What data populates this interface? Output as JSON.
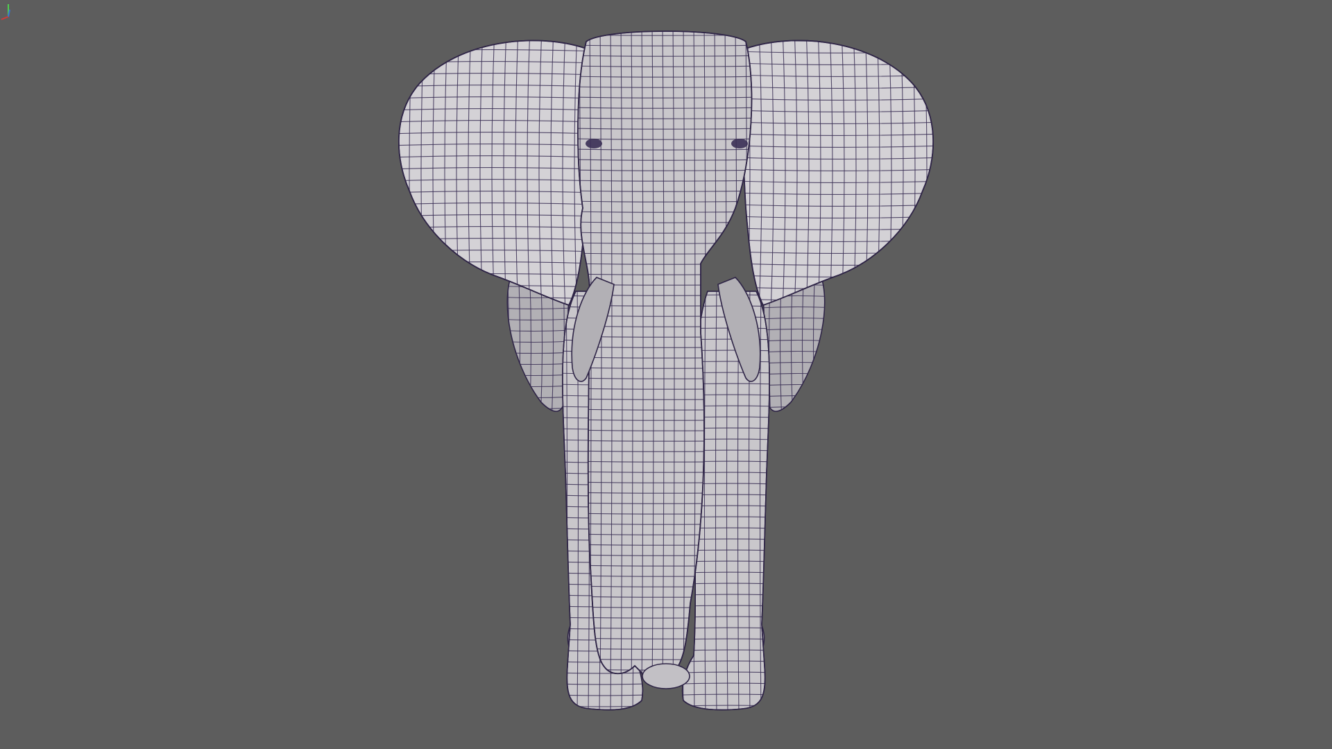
{
  "viewport": {
    "background_color": "#5d5d5d",
    "model": "elephant-wireframe-mesh",
    "shading": "wireframe-on-shaded",
    "view": "front"
  },
  "axis_gizmo": {
    "x_axis_color": "#d23a3a",
    "y_axis_color": "#4fd14f",
    "z_axis_color": "#3b6fd6"
  }
}
